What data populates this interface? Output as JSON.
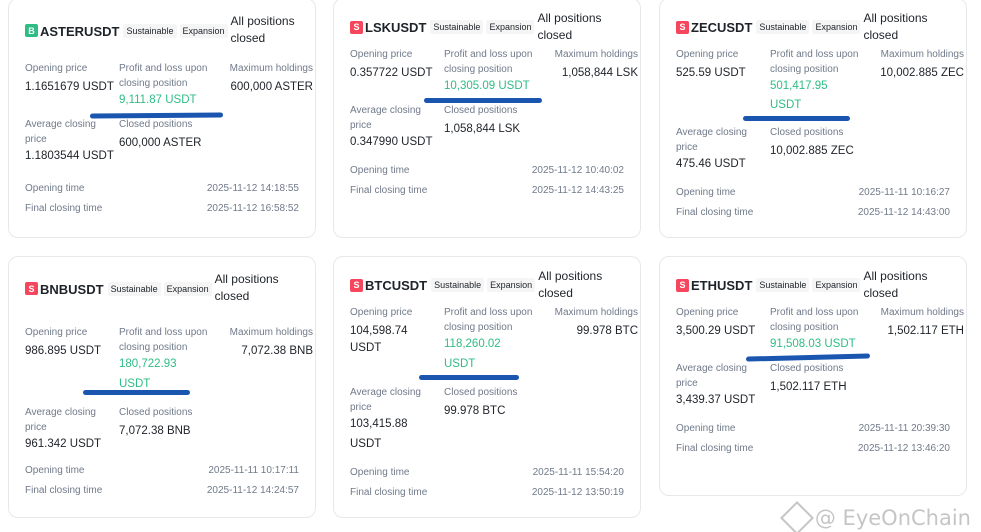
{
  "labels": {
    "sustainable": "Sustainable",
    "expansion": "Expansion",
    "opening_price": "Opening price",
    "pnl_line1": "Profit and loss upon",
    "pnl_line2": "closing position",
    "max_holdings": "Maximum holdings",
    "avg_close_1": "Average closing",
    "avg_close_2": "price",
    "closed_positions": "Closed positions",
    "opening_time": "Opening time",
    "final_closing_time": "Final closing time"
  },
  "colors": {
    "profit": "#2ebd85",
    "badge_buy": "#2ebd85",
    "badge_sell": "#f6465d",
    "highlight": "#1a56b0"
  },
  "cards": [
    {
      "badge": "B",
      "badge_type": "buy",
      "symbol": "ASTERUSDT",
      "status_1": "All positions",
      "status_2": "closed",
      "opening_price": "1.1651679 USDT",
      "pnl": "9,111.87 USDT",
      "max_holdings": "600,000 ASTER",
      "avg_close": "1.1803544 USDT",
      "closed_positions": "600,000 ASTER",
      "opening_time": "2025-11-12 14:18:55",
      "final_closing_time": "2025-11-12 16:58:52"
    },
    {
      "badge": "S",
      "badge_type": "sell",
      "symbol": "LSKUSDT",
      "status_1": "All positions closed",
      "opening_price": "0.357722 USDT",
      "pnl": "10,305.09 USDT",
      "max_holdings": "1,058,844 LSK",
      "avg_close": "0.347990 USDT",
      "closed_positions": "1,058,844 LSK",
      "opening_time": "2025-11-12 10:40:02",
      "final_closing_time": "2025-11-12 14:43:25"
    },
    {
      "badge": "S",
      "badge_type": "sell",
      "symbol": "ZECUSDT",
      "status_1": "All positions closed",
      "opening_price": "525.59 USDT",
      "pnl_1": "501,417.95",
      "pnl_2": "USDT",
      "max_holdings": "10,002.885 ZEC",
      "avg_close": "475.46 USDT",
      "closed_positions": "10,002.885 ZEC",
      "opening_time": "2025-11-11 10:16:27",
      "final_closing_time": "2025-11-12 14:43:00"
    },
    {
      "badge": "S",
      "badge_type": "sell",
      "symbol": "BNBUSDT",
      "status_1": "All positions",
      "status_2": "closed",
      "opening_price": "986.895 USDT",
      "pnl_1": "180,722.93",
      "pnl_2": "USDT",
      "max_holdings": "7,072.38 BNB",
      "avg_close": "961.342 USDT",
      "closed_positions": "7,072.38 BNB",
      "opening_time": "2025-11-11 10:17:11",
      "final_closing_time": "2025-11-12 14:24:57"
    },
    {
      "badge": "S",
      "badge_type": "sell",
      "symbol": "BTCUSDT",
      "status_1": "All positions closed",
      "opening_price_1": "104,598.74",
      "opening_price_2": "USDT",
      "pnl_1": "118,260.02",
      "pnl_2": "USDT",
      "max_holdings": "99.978 BTC",
      "avg_close_1": "103,415.88",
      "avg_close_2": "USDT",
      "closed_positions": "99.978 BTC",
      "opening_time": "2025-11-11 15:54:20",
      "final_closing_time": "2025-11-12 13:50:19"
    },
    {
      "badge": "S",
      "badge_type": "sell",
      "symbol": "ETHUSDT",
      "status_1": "All positions closed",
      "opening_price": "3,500.29 USDT",
      "pnl": "91,508.03 USDT",
      "max_holdings": "1,502.117 ETH",
      "avg_close": "3,439.37 USDT",
      "closed_positions": "1,502.117 ETH",
      "opening_time": "2025-11-11 20:39:30",
      "final_closing_time": "2025-11-12 13:46:20"
    }
  ],
  "watermark": {
    "text": "@ EyeOnChain"
  }
}
